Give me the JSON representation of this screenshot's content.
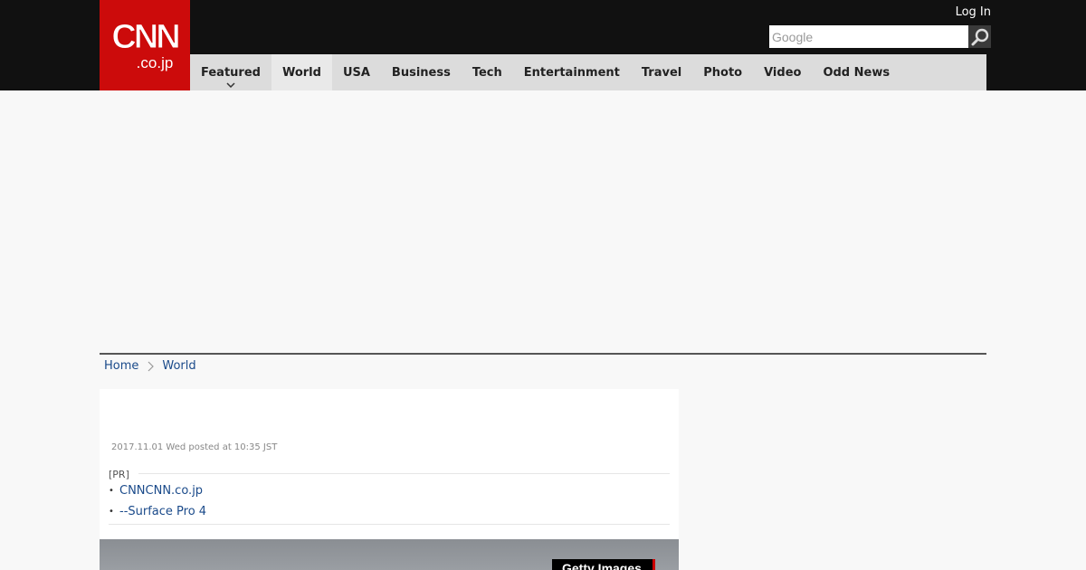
{
  "header": {
    "logo": {
      "main": "CNN",
      "sub": ".co.jp"
    },
    "login_label": "Log In",
    "search": {
      "placeholder": "Google",
      "value": ""
    }
  },
  "nav": {
    "items": [
      {
        "label": "Featured"
      },
      {
        "label": "World"
      },
      {
        "label": "USA"
      },
      {
        "label": "Business"
      },
      {
        "label": "Tech"
      },
      {
        "label": "Entertainment"
      },
      {
        "label": "Travel"
      },
      {
        "label": "Photo"
      },
      {
        "label": "Video"
      },
      {
        "label": "Odd News"
      }
    ],
    "active": "World"
  },
  "breadcrumb": {
    "items": [
      "Home",
      "World"
    ]
  },
  "article": {
    "timestamp": "2017.11.01 Wed posted at 10:35 JST",
    "pr_label": "[PR]",
    "pr_links": [
      "CNNCNN.co.jp",
      "--Surface Pro 4"
    ],
    "photo_credit": "Getty Images"
  },
  "colors": {
    "brand": "#cc0b0b",
    "link": "#1a4a8a",
    "topbar": "#111111",
    "nav_bg": "#dcdcdc"
  }
}
